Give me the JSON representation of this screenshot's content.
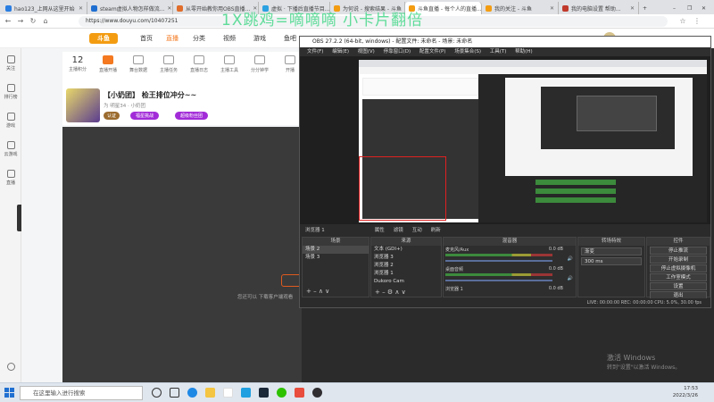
{
  "browser": {
    "tabs": [
      {
        "label": "hao123_上网从这里开始"
      },
      {
        "label": "steam虚拟人物怎样做流..."
      },
      {
        "label": "从零开始教你用OBS直播..."
      },
      {
        "label": "虚拟 · 下播后直播节目..."
      },
      {
        "label": "为何说 - 搜索结果 - 斗鱼"
      },
      {
        "label": "斗鱼直播 - 每个人的直播..."
      },
      {
        "label": "我的关注 - 斗鱼"
      },
      {
        "label": "我的电脑设置 帮助..."
      }
    ],
    "url": "https://www.douyu.com/10407251"
  },
  "banner_text": "1X跳鸡=嘀嘀嘀 小卡片翻倍",
  "douyu": {
    "nav": [
      "首页",
      "直播",
      "分类",
      "视频",
      "游戏",
      "鱼吧"
    ],
    "sidebar": [
      "关注",
      "排行榜",
      "游戏",
      "云游戏",
      "直播"
    ],
    "stats": [
      {
        "label": "主播积分",
        "value": "12"
      },
      {
        "label": "直播开播",
        "value": "5"
      },
      {
        "label": "舞台数据",
        "value": ""
      },
      {
        "label": "主播任务",
        "value": ""
      },
      {
        "label": "直播日志",
        "value": ""
      },
      {
        "label": "主播工具",
        "value": ""
      },
      {
        "label": "分分钟学",
        "value": ""
      },
      {
        "label": "开播",
        "value": ""
      }
    ],
    "room_title": "【小奶团】 检王排位冲分~~",
    "room_meta": "为 明星34  · 小奶团",
    "room_tags": [
      "认证",
      "福星挑战",
      "超级粉丝团"
    ],
    "video_notice": "您还可以 下载客户端观看"
  },
  "obs": {
    "title": "OBS 27.2.2 (64-bit, windows) - 配置文件: 未命名 - 场景: 未命名",
    "menu": [
      "文件(F)",
      "编辑(E)",
      "视图(V)",
      "停靠窗口(D)",
      "配置文件(P)",
      "场景集合(S)",
      "工具(T)",
      "帮助(H)"
    ],
    "controls": [
      "浏览器 1",
      "属性",
      "滤镜",
      "互动",
      "刷新"
    ],
    "scenes_title": "场景",
    "scenes": [
      "场景 2",
      "场景 3"
    ],
    "sources_title": "来源",
    "sources": [
      "文本 (GDI+)",
      "浏览器 3",
      "浏览器 2",
      "浏览器 1",
      "Dukoro Cam",
      "视频采集设备"
    ],
    "mixer_title": "混音器",
    "mixer": [
      {
        "name": "麦克风/Aux",
        "level": "0.0 dB"
      },
      {
        "name": "桌面音频",
        "level": "0.0 dB"
      },
      {
        "name": "浏览器 1",
        "level": "0.0 dB"
      }
    ],
    "transitions_title": "转场特效",
    "transition_value": "渐变",
    "duration": "300 ms",
    "controls_title": "控件",
    "control_buttons": [
      "停止推流",
      "开始录制",
      "停止虚拟摄像机",
      "工作室模式",
      "设置",
      "退出"
    ],
    "status": "LIVE: 00:00:00   REC: 00:00:00   CPU: 5.0%, 30.00 fps"
  },
  "activate": {
    "line1": "激活 Windows",
    "line2": "转到\"设置\"以激活 Windows。"
  },
  "taskbar": {
    "search": "在这里输入进行搜索",
    "time": "17:53",
    "date": "2022/3/26"
  }
}
